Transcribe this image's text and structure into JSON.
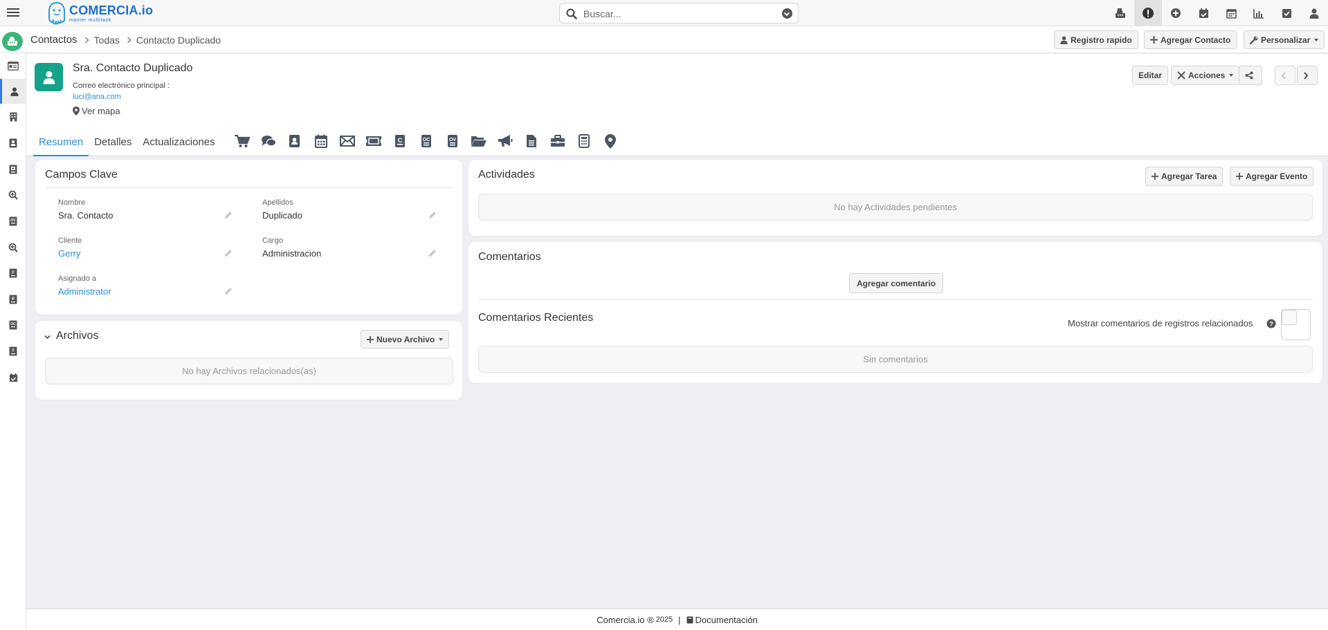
{
  "app": {
    "logo_text": "COMERCIA.io",
    "logo_tagline": "master multitask"
  },
  "search": {
    "placeholder": "Buscar..."
  },
  "top_icons": [
    "cash-register-icon",
    "alert-icon",
    "plus-circle-icon",
    "calendar-check-icon",
    "calendar-icon",
    "chart-icon",
    "check-square-icon",
    "user-icon"
  ],
  "breadcrumb": {
    "items": [
      "Contactos",
      "Todas",
      "Contacto Duplicado"
    ]
  },
  "toolbar": {
    "quick_record": "Registro rapido",
    "add_contact": "Agregar Contacto",
    "customize": "Personalizar"
  },
  "rail_icons": [
    "id-card-icon",
    "user-icon",
    "building-icon",
    "contact-card-icon",
    "quote-icon",
    "search-plus-icon",
    "ov-doc-icon",
    "search-plus-icon",
    "invoice-icon",
    "document-icon",
    "oc-doc-icon",
    "report-icon",
    "calendar-check-icon"
  ],
  "record": {
    "title": "Sra. Contacto Duplicado",
    "email_label": "Correo electrónico principal :",
    "email": "luci@ana.com",
    "map_link": "Ver mapa",
    "edit": "Editar",
    "actions": "Acciones"
  },
  "tabs": [
    "Resumen",
    "Detalles",
    "Actualizaciones"
  ],
  "tab_icons": [
    "cart-icon",
    "comments-icon",
    "contacts-icon",
    "calendar-icon",
    "envelope-icon",
    "ticket-icon",
    "card-c-icon",
    "oc-icon",
    "ov-icon",
    "folder-open-icon",
    "megaphone-icon",
    "file-icon",
    "briefcase-icon",
    "calculator-icon",
    "map-marker-icon"
  ],
  "key_fields": {
    "title": "Campos Clave",
    "fields": [
      {
        "label": "Nombre",
        "value": "Sra. Contacto"
      },
      {
        "label": "Apellidos",
        "value": "Duplicado"
      },
      {
        "label": "Cliente",
        "value": "Gerry"
      },
      {
        "label": "Cargo",
        "value": "Administracion"
      },
      {
        "label": "Asignado a",
        "value": "Administrator"
      }
    ]
  },
  "files": {
    "title": "Archivos",
    "new_button": "Nuevo Archivo",
    "empty": "No hay Archivos relacionados(as)"
  },
  "activities": {
    "title": "Actividades",
    "add_task": "Agregar Tarea",
    "add_event": "Agregar Evento",
    "empty": "No hay Actividades pendientes"
  },
  "comments": {
    "title": "Comentarios",
    "add_button": "Agregar comentario",
    "recent_title": "Comentarios Recientes",
    "show_related": "Mostrar comentarios de registros relacionados",
    "empty": "Sin comentarios"
  },
  "footer": {
    "brand": "Comercia.io ®",
    "year": "2025",
    "separator": "|",
    "docs": "Documentación"
  },
  "colors": {
    "accent": "#2a90d6",
    "avatar": "#14a38a",
    "module": "#3db37a"
  }
}
